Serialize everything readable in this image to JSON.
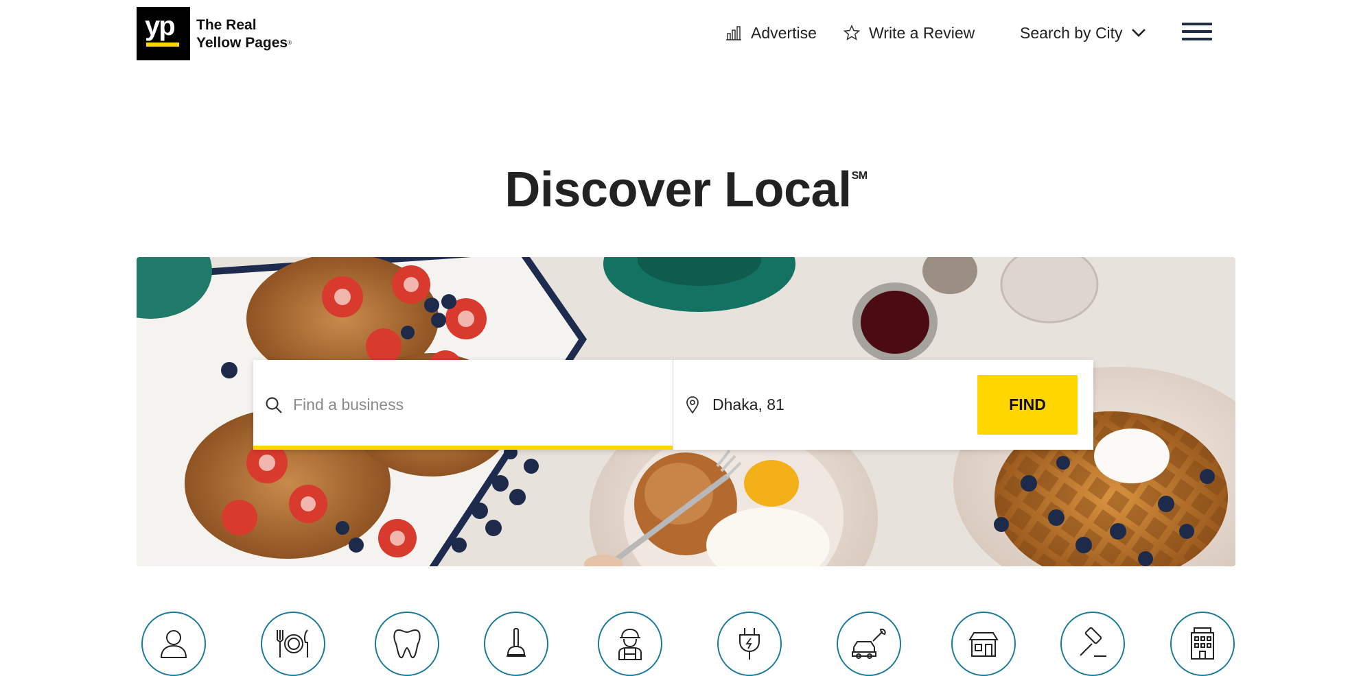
{
  "brand": {
    "logo_mark": "yp",
    "name_line1": "The Real",
    "name_line2": "Yellow Pages",
    "name_mark": "®"
  },
  "nav": {
    "advertise": "Advertise",
    "write_review": "Write a Review",
    "search_by_city": "Search by City",
    "icons": [
      "bar-chart-icon",
      "star-icon",
      "chevron-down-icon",
      "hamburger-menu-icon"
    ]
  },
  "hero": {
    "title": "Discover Local",
    "service_mark": "SM"
  },
  "search": {
    "business_placeholder": "Find a business",
    "business_value": "",
    "location_value": "Dhaka, 81",
    "find_label": "FIND"
  },
  "categories": [
    {
      "icon": "person-icon"
    },
    {
      "icon": "restaurant-icon"
    },
    {
      "icon": "tooth-icon"
    },
    {
      "icon": "plunger-icon"
    },
    {
      "icon": "contractor-icon"
    },
    {
      "icon": "electric-plug-icon"
    },
    {
      "icon": "auto-repair-icon"
    },
    {
      "icon": "storefront-icon"
    },
    {
      "icon": "gavel-icon"
    },
    {
      "icon": "hotel-icon"
    }
  ],
  "colors": {
    "brand_yellow": "#ffd600",
    "circle_teal": "#1b7a9b",
    "text_dark": "#222222",
    "logo_black": "#000000"
  }
}
